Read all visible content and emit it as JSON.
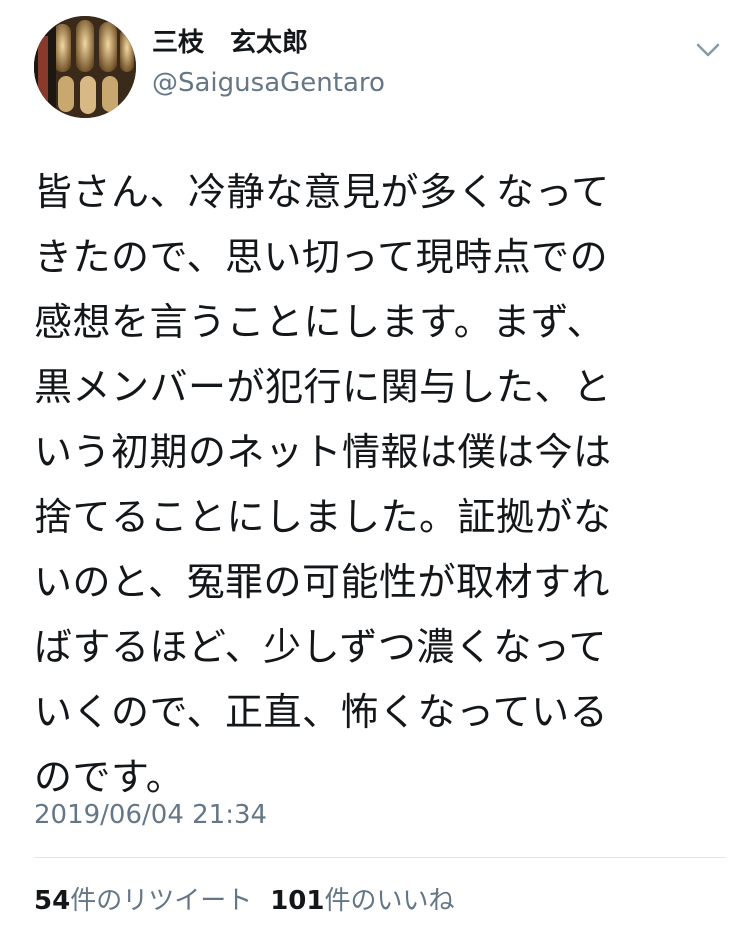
{
  "author": {
    "display_name": "三枝　玄太郎",
    "handle": "@SaigusaGentaro"
  },
  "icons": {
    "menu": "chevron-down-icon",
    "avatar": "avatar-photo"
  },
  "tweet": {
    "lines": [
      "皆さん、冷静な意見が多くなって",
      "きたので、思い切って現時点での",
      "感想を言うことにします。まず、",
      "黒メンバーが犯行に関与した、と",
      "いう初期のネット情報は僕は今は",
      "捨てることにしました。証拠がな",
      "いのと、冤罪の可能性が取材すれ",
      "ばするほど、少しずつ濃くなって",
      "いくので、正直、怖くなっている",
      "のです。"
    ],
    "timestamp": "2019/06/04 21:34"
  },
  "stats": {
    "retweets_count": "54",
    "retweets_label": "件のリツイート",
    "likes_count": "101",
    "likes_label": "件のいいね"
  },
  "colors": {
    "text": "#14171a",
    "secondary": "#657786",
    "divider": "#e1e8ed"
  }
}
